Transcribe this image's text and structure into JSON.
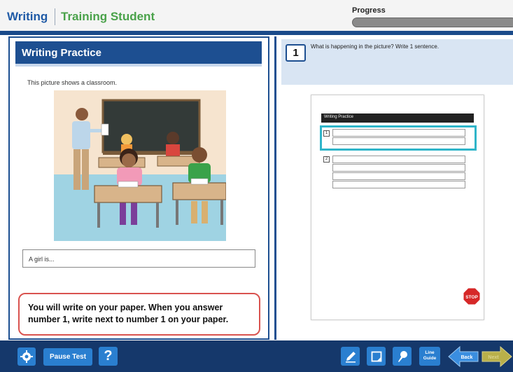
{
  "header": {
    "subject": "Writing",
    "student_name": "Training Student",
    "progress_label": "Progress",
    "progress_fraction": 0.0
  },
  "left_panel": {
    "title": "Writing Practice",
    "prompt": "This picture shows a classroom.",
    "answer_text": "A girl is...",
    "note": "You will write on your paper. When you answer number 1, write next to number 1 on your paper."
  },
  "right_panel": {
    "question_number": "1",
    "question_text": "What is happening in the picture? Write 1 sentence.",
    "paper": {
      "header_text": "Writing Practice",
      "q1_number": "1",
      "q2_number": "2",
      "stop_label": "STOP"
    }
  },
  "toolbar": {
    "pause_label": "Pause Test",
    "help_label": "?",
    "line_guide_label_1": "Line",
    "line_guide_label_2": "Guide",
    "back_label": "Back",
    "next_label": "Next"
  },
  "colors": {
    "brand_blue": "#1d4f91",
    "student_green": "#4aa24a",
    "button_blue": "#2a7fd0",
    "highlight_cyan": "#2fb5c9",
    "note_border": "#d9534f"
  },
  "icons": [
    "gear-icon",
    "pencil-icon",
    "notepad-icon",
    "marker-icon",
    "back-arrow-icon",
    "next-arrow-icon",
    "stop-sign-icon"
  ]
}
